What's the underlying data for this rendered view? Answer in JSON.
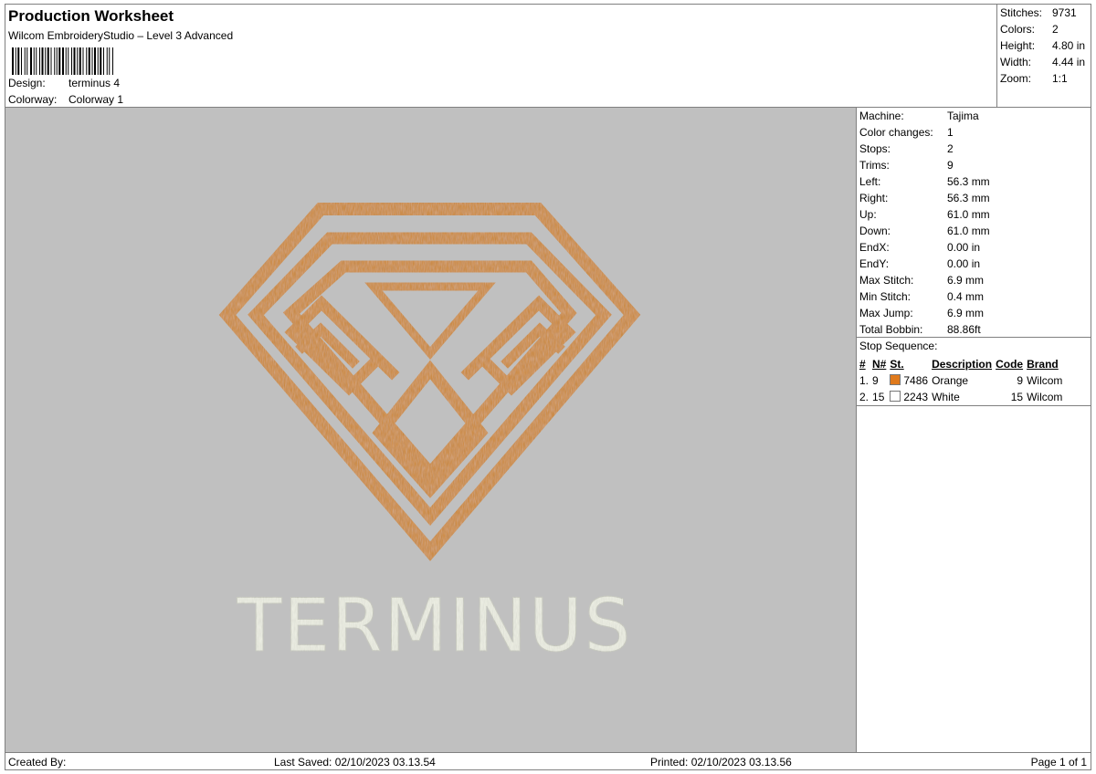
{
  "header": {
    "title": "Production Worksheet",
    "software": "Wilcom EmbroideryStudio – Level 3 Advanced",
    "design_label": "Design:",
    "design_value": "terminus 4",
    "colorway_label": "Colorway:",
    "colorway_value": "Colorway 1"
  },
  "summary": {
    "stitches_label": "Stitches:",
    "stitches_value": "9731",
    "colors_label": "Colors:",
    "colors_value": "2",
    "height_label": "Height:",
    "height_value": "4.80 in",
    "width_label": "Width:",
    "width_value": "4.44 in",
    "zoom_label": "Zoom:",
    "zoom_value": "1:1"
  },
  "details": [
    {
      "label": "Machine:",
      "value": "Tajima"
    },
    {
      "label": "Color changes:",
      "value": "1"
    },
    {
      "label": "Stops:",
      "value": "2"
    },
    {
      "label": "Trims:",
      "value": "9"
    },
    {
      "label": "Left:",
      "value": "56.3 mm"
    },
    {
      "label": "Right:",
      "value": "56.3 mm"
    },
    {
      "label": "Up:",
      "value": "61.0 mm"
    },
    {
      "label": "Down:",
      "value": "61.0 mm"
    },
    {
      "label": "EndX:",
      "value": "0.00 in"
    },
    {
      "label": "EndY:",
      "value": "0.00 in"
    },
    {
      "label": "Max Stitch:",
      "value": "6.9 mm"
    },
    {
      "label": "Min Stitch:",
      "value": "0.4 mm"
    },
    {
      "label": "Max Jump:",
      "value": "6.9 mm"
    },
    {
      "label": "Total Bobbin:",
      "value": "88.86ft"
    }
  ],
  "stop_sequence": {
    "title": "Stop Sequence:",
    "columns": [
      "#",
      "N#",
      "St.",
      "Description",
      "Code",
      "Brand"
    ],
    "rows": [
      {
        "num": "1.",
        "n": "9",
        "color": "#e07a1c",
        "st": "7486",
        "description": "Orange",
        "code": "9",
        "brand": "Wilcom"
      },
      {
        "num": "2.",
        "n": "15",
        "color": "#ffffff",
        "st": "2243",
        "description": "White",
        "code": "15",
        "brand": "Wilcom"
      }
    ]
  },
  "design": {
    "text": "TERMINUS",
    "thread_color_main": "#d08a34",
    "thread_color_text": "#eef0e4"
  },
  "footer": {
    "created_by": "Created By:",
    "last_saved": "Last Saved: 02/10/2023 03.13.54",
    "printed": "Printed: 02/10/2023 03.13.56",
    "page": "Page 1 of 1"
  }
}
